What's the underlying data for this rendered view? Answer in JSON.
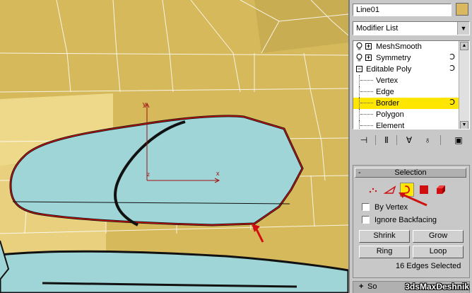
{
  "viewport": {
    "axis_labels": {
      "x": "x",
      "y": "y",
      "z": "z"
    },
    "colors": {
      "mesh_yellow": "#d8bc5e",
      "mesh_light": "#eed98a",
      "glass": "#9fd5d6",
      "wire": "#ffffff",
      "selection": "#e01010"
    }
  },
  "panel": {
    "object_name": "Line01",
    "color_swatch": "#d9b861",
    "modifier_list_label": "Modifier List",
    "stack": [
      {
        "label": "MeshSmooth",
        "type": "modifier"
      },
      {
        "label": "Symmetry",
        "type": "modifier"
      },
      {
        "label": "Editable Poly",
        "type": "base"
      },
      {
        "label": "Vertex",
        "type": "sub"
      },
      {
        "label": "Edge",
        "type": "sub"
      },
      {
        "label": "Border",
        "type": "sub",
        "selected": true
      },
      {
        "label": "Polygon",
        "type": "sub"
      },
      {
        "label": "Element",
        "type": "sub"
      }
    ],
    "toolbar_icons": [
      "pin-stack-icon",
      "show-end-result-icon",
      "make-unique-icon",
      "remove-modifier-icon",
      "configure-modifier-sets-icon"
    ],
    "selection": {
      "title": "Selection",
      "minus": "-",
      "by_vertex": "By Vertex",
      "ignore_backfacing": "Ignore Backfacing",
      "shrink": "Shrink",
      "grow": "Grow",
      "ring": "Ring",
      "loop": "Loop",
      "status": "16 Edges Selected"
    },
    "next_rollout": {
      "plus": "+",
      "label": "So"
    },
    "watermark": "3dsMaxDeshnik"
  }
}
